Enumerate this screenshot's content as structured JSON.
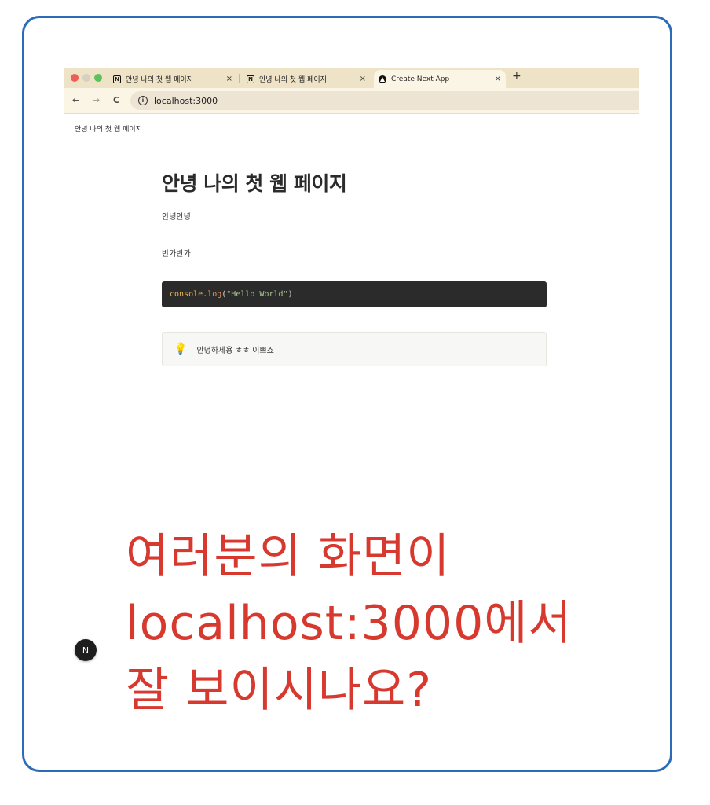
{
  "browser": {
    "traffic_lights": {
      "close": "#ee5e57",
      "minimize": "#d6d0c3",
      "maximize": "#5ec15b"
    },
    "tabs": [
      {
        "label": "안녕 나의 첫 웹 페이지",
        "icon": "notion-icon",
        "close": "×"
      },
      {
        "label": "안녕 나의 첫 웹 페이지",
        "icon": "notion-icon",
        "close": "×"
      },
      {
        "label": "Create Next App",
        "icon": "vercel-triangle-icon",
        "close": "×",
        "active": true
      }
    ],
    "new_tab": "+",
    "nav": {
      "back": "←",
      "forward": "→",
      "reload": "C"
    },
    "url": "localhost:3000"
  },
  "page": {
    "site_title": "안녕 나의 첫 웹 페이지",
    "heading": "안녕 나의 첫 웹 페이지",
    "para1": "안녕안녕",
    "para2": "반가반가",
    "code": {
      "obj": "console",
      "dot": ".",
      "fn": "log",
      "open": "(",
      "str": "\"Hello World\"",
      "close": ")"
    },
    "callout": {
      "icon": "lightbulb-icon",
      "text": "안녕하세용 ㅎㅎ 이쁘죠"
    }
  },
  "nextjs_badge": "N",
  "annotation": {
    "line1": "여러분의 화면이",
    "line2": "localhost:3000에서",
    "line3": "잘 보이시나요?",
    "color": "#d8392f"
  }
}
